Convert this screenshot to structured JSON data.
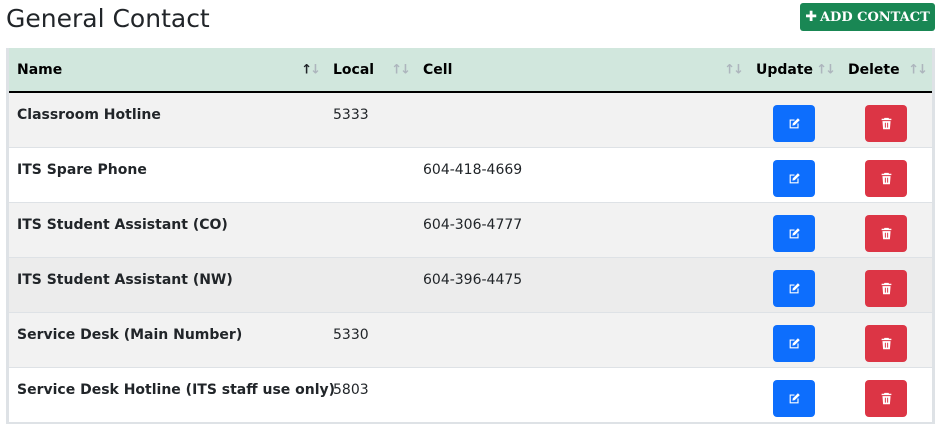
{
  "page": {
    "title": "General Contact"
  },
  "actions": {
    "add_label": "ADD CONTACT",
    "add_icon": "plus-icon"
  },
  "table": {
    "headers": {
      "name": "Name",
      "local": "Local",
      "cell": "Cell",
      "update": "Update",
      "delete": "Delete"
    },
    "sort_glyphs": {
      "up": "↑",
      "down": "↓"
    },
    "rows": [
      {
        "name": "Classroom Hotline",
        "local": "5333",
        "cell": ""
      },
      {
        "name": "ITS Spare Phone",
        "local": "",
        "cell": "604-418-4669"
      },
      {
        "name": "ITS Student Assistant (CO)",
        "local": "",
        "cell": "604-306-4777"
      },
      {
        "name": "ITS Student Assistant (NW)",
        "local": "",
        "cell": "604-396-4475"
      },
      {
        "name": "Service Desk (Main Number)",
        "local": "5330",
        "cell": ""
      },
      {
        "name": "Service Desk Hotline (ITS staff use only)",
        "local": "5803",
        "cell": ""
      }
    ]
  },
  "colors": {
    "header_bg": "#d1e7dd",
    "add_button": "#198754",
    "update_button": "#0d6efd",
    "delete_button": "#dc3545"
  },
  "icons": {
    "update": "edit-icon",
    "delete": "trash-icon",
    "sort": "sort-arrows-icon"
  }
}
